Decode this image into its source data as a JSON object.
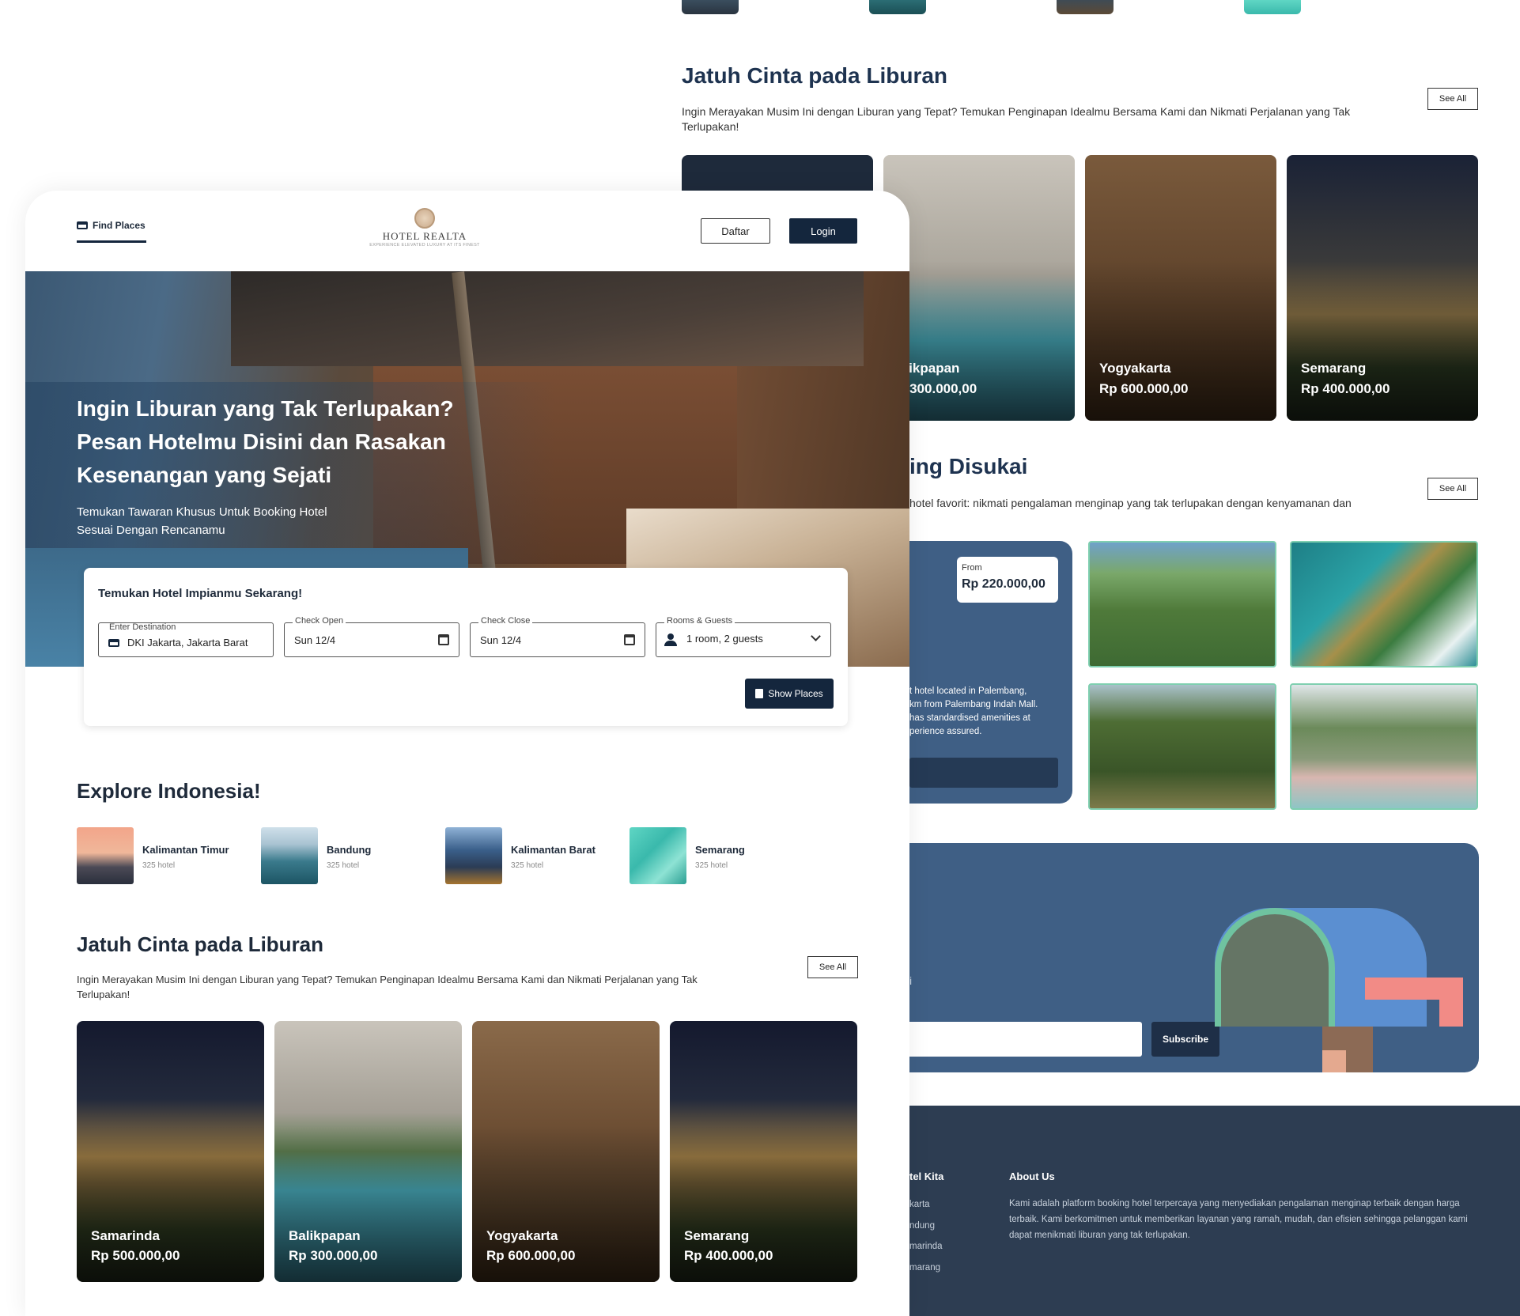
{
  "back": {
    "section1": {
      "title": "Jatuh Cinta pada Liburan",
      "desc": "Ingin Merayakan Musim Ini dengan Liburan yang Tepat? Temukan Penginapan Idealmu Bersama Kami dan Nikmati Perjalanan yang Tak Terlupakan!",
      "see_all": "See All",
      "cards": [
        {
          "name": "alikpapan",
          "price": "p 300.000,00"
        },
        {
          "name": "Yogyakarta",
          "price": "Rp 600.000,00"
        },
        {
          "name": "Semarang",
          "price": "Rp 400.000,00"
        }
      ]
    },
    "section2": {
      "title": "ing Disukai",
      "desc": "hotel favorit: nikmati pengalaman menginap yang tak terlupakan dengan kenyamanan dan",
      "see_all": "See All",
      "feature": {
        "from_label": "From",
        "price": "Rp 220.000,00",
        "desc_lines": [
          "t hotel located in Palembang,",
          "km from Palembang Indah Mall.",
          "has standardised amenities at",
          "perience assured."
        ]
      }
    },
    "newsletter": {
      "fragment": "i",
      "subscribe": "Subscribe"
    },
    "footer": {
      "col1_title": "tel Kita",
      "col1_items": [
        "karta",
        "ndung",
        "marinda",
        "marang"
      ],
      "about_title": "About Us",
      "about_text": "Kami adalah platform booking hotel terpercaya yang menyediakan pengalaman menginap terbaik dengan harga terbaik. Kami berkomitmen untuk memberikan layanan yang ramah, mudah, dan efisien sehingga pelanggan kami dapat menikmati liburan yang tak terlupakan."
    }
  },
  "front": {
    "nav": {
      "find_places": "Find Places",
      "logo_name": "HOTEL REALTA",
      "logo_tagline": "EXPERIENCE ELEVATED LUXURY AT ITS FINEST",
      "daftar": "Daftar",
      "login": "Login"
    },
    "hero": {
      "headline_1": "Ingin Liburan yang Tak Terlupakan?",
      "headline_2": "Pesan Hotelmu Disini dan Rasakan",
      "headline_3": "Kesenangan yang Sejati",
      "sub_1": "Temukan Tawaran Khusus Untuk Booking Hotel",
      "sub_2": "Sesuai Dengan Rencanamu"
    },
    "search": {
      "title": "Temukan Hotel Impianmu Sekarang!",
      "dest_label": "Enter Destination",
      "dest_value": "DKI Jakarta, Jakarta Barat",
      "open_label": "Check Open",
      "open_value": "Sun 12/4",
      "close_label": "Check Close",
      "close_value": "Sun 12/4",
      "guests_label": "Rooms & Guests",
      "guests_value": "1 room, 2 guests",
      "show_places": "Show Places"
    },
    "explore": {
      "title": "Explore Indonesia!",
      "items": [
        {
          "name": "Kalimantan Timur",
          "count": "325 hotel"
        },
        {
          "name": "Bandung",
          "count": "325 hotel"
        },
        {
          "name": "Kalimantan Barat",
          "count": "325 hotel"
        },
        {
          "name": "Semarang",
          "count": "325 hotel"
        }
      ]
    },
    "love": {
      "title": "Jatuh Cinta pada Liburan",
      "desc_1": "Ingin Merayakan Musim Ini dengan Liburan yang Tepat? Temukan Penginapan Idealmu Bersama Kami dan Nikmati Perjalanan yang Tak",
      "desc_2": "Terlupakan!",
      "see_all": "See All",
      "cards": [
        {
          "name": "Samarinda",
          "price": "Rp 500.000,00"
        },
        {
          "name": "Balikpapan",
          "price": "Rp 300.000,00"
        },
        {
          "name": "Yogyakarta",
          "price": "Rp 600.000,00"
        },
        {
          "name": "Semarang",
          "price": "Rp 400.000,00"
        }
      ]
    }
  },
  "colors": {
    "navy": "#14263d",
    "slate": "#3f5f85",
    "footer": "#2d3d52",
    "mint": "#6fc3a0",
    "coral": "#f28b86",
    "sky": "#5b8fd1"
  }
}
